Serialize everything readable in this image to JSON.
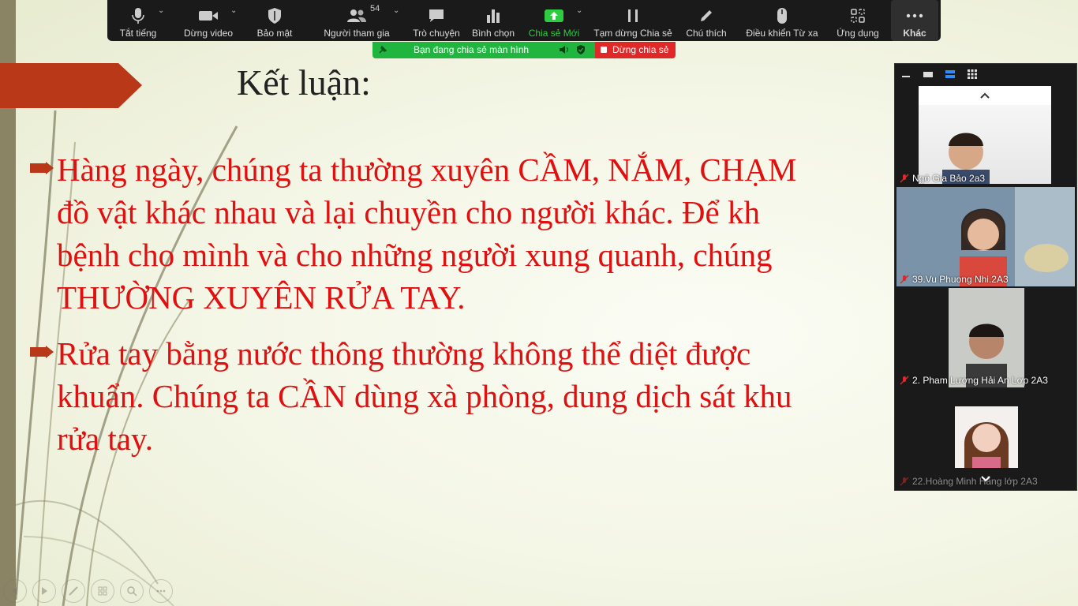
{
  "toolbar": {
    "items": [
      {
        "label": "Tắt tiếng",
        "icon": "microphone-icon"
      },
      {
        "label": "Dừng video",
        "icon": "video-camera-icon"
      },
      {
        "label": "Bảo mật",
        "icon": "shield-icon"
      },
      {
        "label": "Người tham gia",
        "icon": "participants-icon"
      },
      {
        "label": "Trò chuyện",
        "icon": "chat-bubble-icon"
      },
      {
        "label": "Bình chọn",
        "icon": "poll-icon"
      },
      {
        "label": "Chia sẻ Mới",
        "icon": "share-screen-icon"
      },
      {
        "label": "Tạm dừng Chia sẻ",
        "icon": "pause-icon"
      },
      {
        "label": "Chú thích",
        "icon": "pen-icon"
      },
      {
        "label": "Điều khiển Từ xa",
        "icon": "mouse-icon"
      },
      {
        "label": "Ứng dụng",
        "icon": "apps-icon"
      },
      {
        "label": "Khác",
        "icon": "more-icon"
      }
    ],
    "participants_count": "54",
    "accent_green": "#2ecc40"
  },
  "share_banner": {
    "text": "Bạn đang chia sẻ màn hình",
    "stop_label": "Dừng chia sẻ"
  },
  "slide": {
    "title": "Kết luận:",
    "bullets": [
      {
        "lines": [
          "Hàng ngày, chúng ta thường xuyên CẦM, NẮM, CHẠM",
          "đồ vật khác nhau và lại chuyền cho người khác. Để kh",
          "bệnh cho mình và cho những người xung quanh, chúng",
          "THƯỜNG XUYÊN RỬA TAY."
        ]
      },
      {
        "lines": [
          "Rửa tay bằng nước thông thường không thể diệt được",
          "khuẩn. Chúng ta CẦN dùng xà phòng, dung dịch sát khu",
          "rửa tay."
        ]
      }
    ],
    "text_color": "#e01010",
    "accent_color": "#b83818"
  },
  "participants": [
    {
      "name": "Ngô Gia Bảo 2a3"
    },
    {
      "name": "39.Vu Phuong Nhi.2A3"
    },
    {
      "name": "2. Pham Lương Hải An Lơp 2A3"
    },
    {
      "name": "22.Hoàng Minh Hằng lớp 2A3"
    }
  ]
}
